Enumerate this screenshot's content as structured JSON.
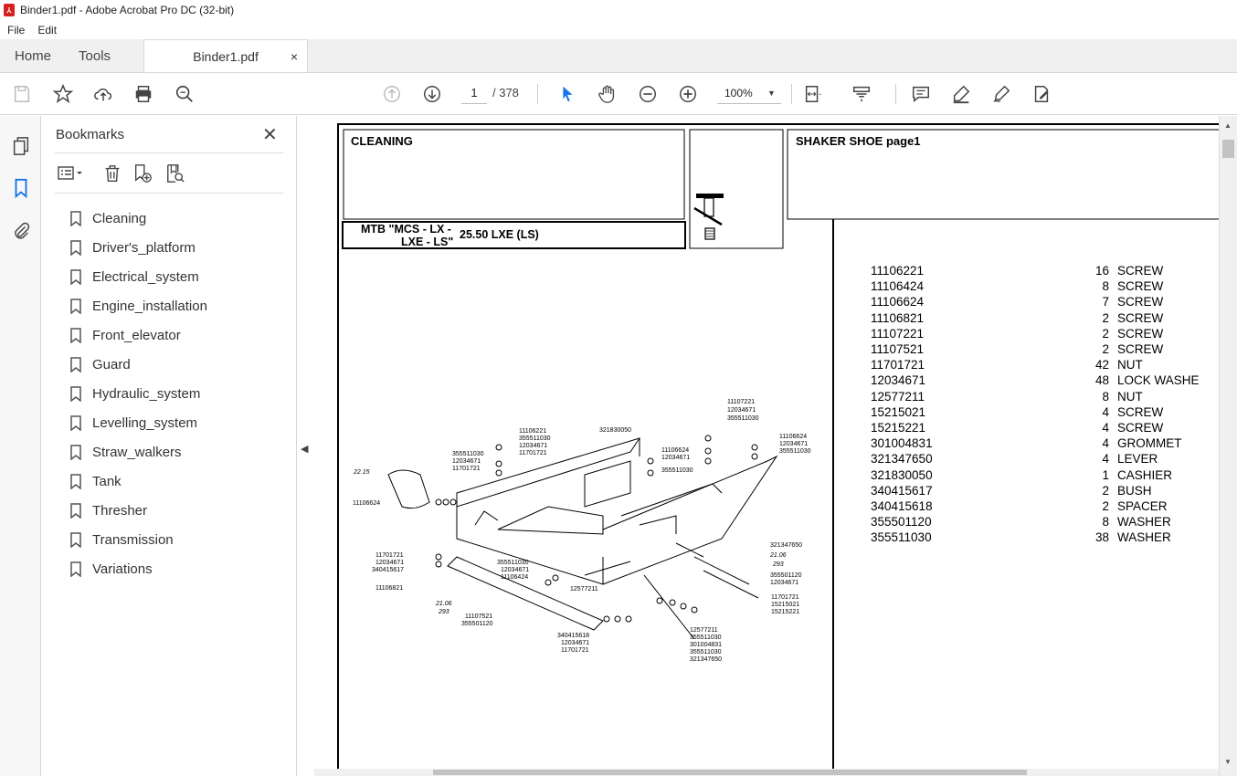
{
  "window": {
    "title": "Binder1.pdf - Adobe Acrobat Pro DC (32-bit)"
  },
  "menu": {
    "file": "File",
    "edit": "Edit"
  },
  "tabs": {
    "home": "Home",
    "tools": "Tools",
    "document": "Binder1.pdf",
    "close": "×"
  },
  "toolbar": {
    "page_current": "1",
    "page_total": "/ 378",
    "zoom": "100%"
  },
  "bookmarks_panel": {
    "title": "Bookmarks",
    "items": [
      {
        "label": "Cleaning"
      },
      {
        "label": "Driver's_platform"
      },
      {
        "label": "Electrical_system"
      },
      {
        "label": "Engine_installation"
      },
      {
        "label": "Front_elevator"
      },
      {
        "label": "Guard"
      },
      {
        "label": "Hydraulic_system"
      },
      {
        "label": "Levelling_system"
      },
      {
        "label": "Straw_walkers"
      },
      {
        "label": "Tank"
      },
      {
        "label": "Thresher"
      },
      {
        "label": "Transmission"
      },
      {
        "label": "Variations"
      }
    ]
  },
  "document": {
    "section": "CLEANING",
    "model_line1": "MTB \"MCS - LX -",
    "model_line2": "LXE - LS\"",
    "model_code": "25.50 LXE (LS)",
    "group_title": "SHAKER SHOE  page1",
    "parts": [
      {
        "code": "11106221",
        "qty": "16",
        "desc": "SCREW"
      },
      {
        "code": "11106424",
        "qty": "8",
        "desc": "SCREW"
      },
      {
        "code": "11106624",
        "qty": "7",
        "desc": "SCREW"
      },
      {
        "code": "11106821",
        "qty": "2",
        "desc": "SCREW"
      },
      {
        "code": "11107221",
        "qty": "2",
        "desc": "SCREW"
      },
      {
        "code": "11107521",
        "qty": "2",
        "desc": "SCREW"
      },
      {
        "code": "11701721",
        "qty": "42",
        "desc": "NUT"
      },
      {
        "code": "12034671",
        "qty": "48",
        "desc": "LOCK WASHE"
      },
      {
        "code": "12577211",
        "qty": "8",
        "desc": "NUT"
      },
      {
        "code": "15215021",
        "qty": "4",
        "desc": "SCREW"
      },
      {
        "code": "15215221",
        "qty": "4",
        "desc": "SCREW"
      },
      {
        "code": "301004831",
        "qty": "4",
        "desc": "GROMMET"
      },
      {
        "code": "321347650",
        "qty": "4",
        "desc": "LEVER"
      },
      {
        "code": "321830050",
        "qty": "1",
        "desc": "CASHIER"
      },
      {
        "code": "340415617",
        "qty": "2",
        "desc": "BUSH"
      },
      {
        "code": "340415618",
        "qty": "2",
        "desc": "SPACER"
      },
      {
        "code": "355501120",
        "qty": "8",
        "desc": "WASHER"
      },
      {
        "code": "355511030",
        "qty": "38",
        "desc": "WASHER"
      }
    ],
    "diagram_labels": {
      "l1": "11107221",
      "l2": "12034671",
      "l3": "355511030",
      "l4": "11106221",
      "l5": "355511030",
      "l6": "12034671",
      "l7": "11701721",
      "l8": "321830050",
      "l9": "11106624",
      "l10": "12034671",
      "l11": "355511030",
      "l12": "11106624",
      "l13": "12034671",
      "l14": "355511030",
      "l15": "355511030",
      "l16": "12034671",
      "l17": "11701721",
      "l18": "22.15",
      "l19": "11106624",
      "l20": "11701721",
      "l21": "12034671",
      "l22": "340415617",
      "l23": "11106821",
      "l24": "355511030",
      "l25": "12034671",
      "l26": "11106424",
      "l27": "12577211",
      "l28": "21.06",
      "l29": "293",
      "l30": "11107521",
      "l31": "355501120",
      "l32": "340415618",
      "l33": "12034671",
      "l34": "11701721",
      "l35": "321347650",
      "l36": "21.06",
      "l37": "293",
      "l38": "355501120",
      "l39": "12034671",
      "l40": "11701721",
      "l41": "15215021",
      "l42": "15215221",
      "l43": "12577211",
      "l44": "355511030",
      "l45": "301004831",
      "l46": "355511030",
      "l47": "321347650"
    }
  },
  "colors": {
    "accent": "#1473e6",
    "pdf_red": "#d71f1f"
  }
}
